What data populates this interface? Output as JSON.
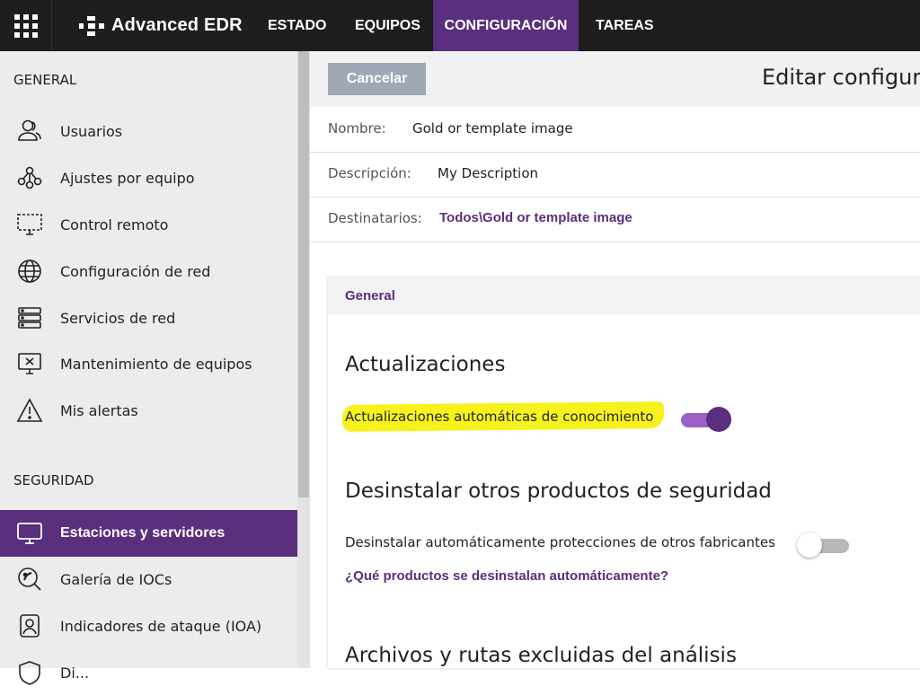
{
  "topbar": {
    "apps_icon": "grid-icon",
    "brand_name": "Advanced EDR",
    "tabs": [
      {
        "label": "ESTADO",
        "active": false
      },
      {
        "label": "EQUIPOS",
        "active": false
      },
      {
        "label": "CONFIGURACIÓN",
        "active": true
      },
      {
        "label": "TAREAS",
        "active": false
      }
    ]
  },
  "sidebar": {
    "general_title": "GENERAL",
    "general_items": [
      {
        "label": "Usuarios",
        "icon": "users-icon"
      },
      {
        "label": "Ajustes por equipo",
        "icon": "network-nodes-icon"
      },
      {
        "label": "Control remoto",
        "icon": "remote-screen-icon"
      },
      {
        "label": "Configuración de red",
        "icon": "globe-icon"
      },
      {
        "label": "Servicios de red",
        "icon": "server-icon"
      },
      {
        "label": "Mantenimiento de equipos",
        "icon": "monitor-x-icon"
      },
      {
        "label": "Mis alertas",
        "icon": "warning-icon"
      }
    ],
    "security_title": "SEGURIDAD",
    "security_items": [
      {
        "label": "Estaciones y servidores",
        "icon": "monitor-icon",
        "active": true
      },
      {
        "label": "Galería de IOCs",
        "icon": "ioc-search-icon"
      },
      {
        "label": "Indicadores de ataque (IOA)",
        "icon": "ioa-badge-icon"
      },
      {
        "label": "Di...",
        "icon": "shield-icon"
      }
    ]
  },
  "toolbar": {
    "cancel_label": "Cancelar",
    "title": "Editar configura"
  },
  "fields": {
    "name_label": "Nombre:",
    "name_value": "Gold or template image",
    "description_label": "Descripción:",
    "description_value": "My Description",
    "recipients_label": "Destinatarios:",
    "recipients_value": "Todos\\Gold or template image"
  },
  "panel": {
    "header": "General",
    "updates_title": "Actualizaciones",
    "auto_updates_label": "Actualizaciones automáticas de conocimiento",
    "auto_updates_on": true,
    "uninstall_title": "Desinstalar otros productos de seguridad",
    "uninstall_label": "Desinstalar automáticamente protecciones de otros fabricantes",
    "uninstall_on": false,
    "uninstall_help_link": "¿Qué productos se desinstalan automáticamente?",
    "exclusions_title": "Archivos y rutas excluidas del análisis"
  },
  "colors": {
    "accent": "#5a2f7e",
    "topbar_bg": "#1e1e1e",
    "highlight": "#f7f21b",
    "cancel_bg": "#9ea9b5"
  }
}
